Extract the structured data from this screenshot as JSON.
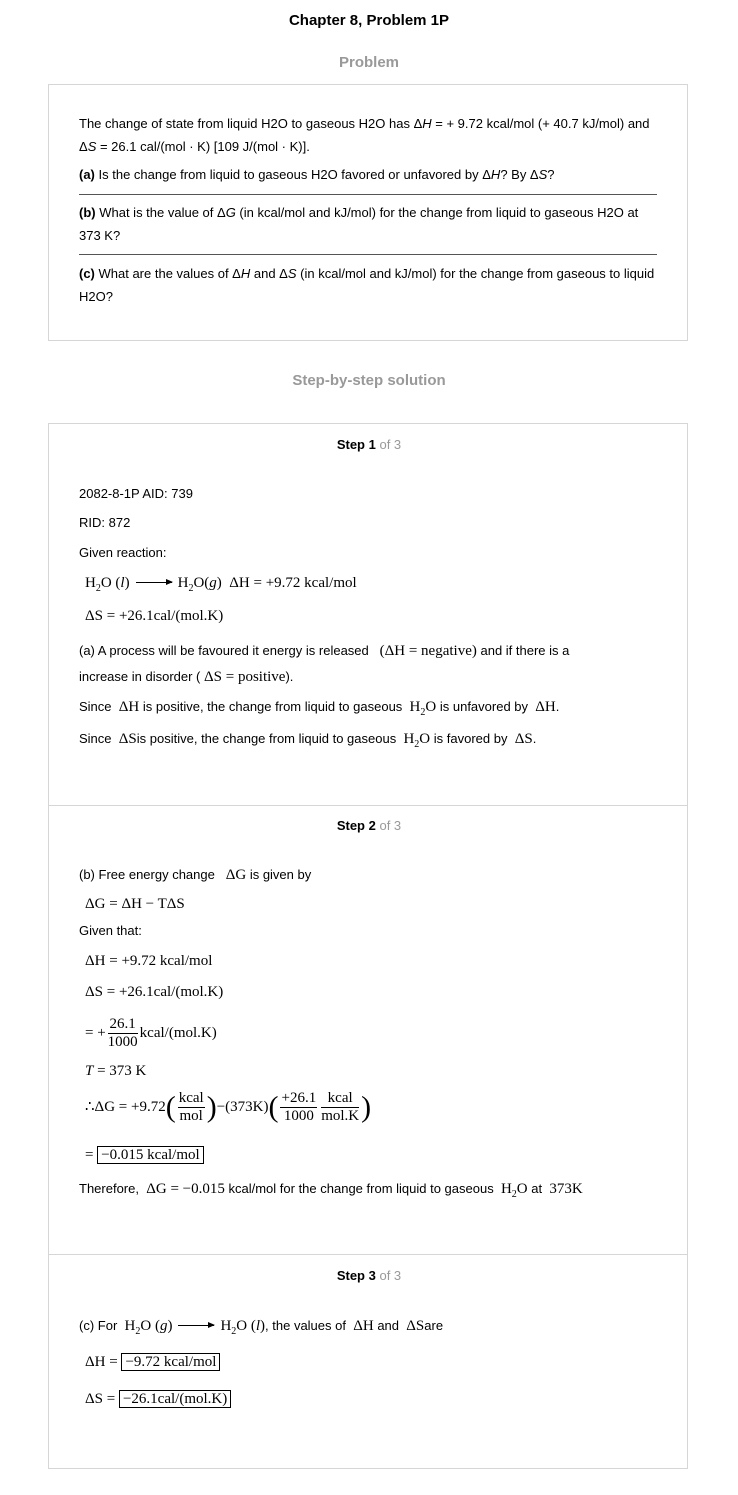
{
  "title": "Chapter 8, Problem 1P",
  "problem_heading": "Problem",
  "problem": {
    "intro_a": "The change of state from liquid H2O to gaseous H2O has Δ",
    "intro_h": "H",
    "intro_b": " = + 9.72 kcal/mol (+ 40.7 kJ/mol) and Δ",
    "intro_s": "S",
    "intro_c": " = 26.1 cal/(mol · K) [109 J/(mol · K)].",
    "qa_label": "(a)",
    "qa_text_a": " Is the change from liquid to gaseous H2O favored or unfavored by Δ",
    "qa_h": "H",
    "qa_text_b": "? By Δ",
    "qa_s": "S",
    "qa_text_c": "?",
    "qb_label": "(b)",
    "qb_text_a": " What is the value of Δ",
    "qb_g": "G",
    "qb_text_b": " (in kcal/mol and kJ/mol) for the change from liquid to gaseous H2O at 373 K?",
    "qc_label": "(c)",
    "qc_text_a": " What are the values of Δ",
    "qc_h": "H",
    "qc_text_b": " and Δ",
    "qc_s": "S",
    "qc_text_c": " (in kcal/mol and kJ/mol) for the change from gaseous to liquid H2O?"
  },
  "solution_heading": "Step-by-step solution",
  "steps": [
    {
      "label": "Step 1",
      "of": "of 3"
    },
    {
      "label": "Step 2",
      "of": "of 3"
    },
    {
      "label": "Step 3",
      "of": "of 3"
    }
  ],
  "step1": {
    "aid": "2082-8-1P AID: 739",
    "rid": "RID: 872",
    "given": "Given reaction:",
    "eq_rhs": "ΔH = +9.72 kcal/mol",
    "ds": "ΔS = +26.1cal/",
    "ds_unit": "mol.K",
    "a_text1": "(a) A process will be favoured it energy is released",
    "a_math1": "ΔH = negative",
    "a_text2": "and if there is a",
    "a_text3": "increase in disorder (",
    "a_math2": "ΔS = positive",
    "a_text4": ").",
    "since1_a": "Since",
    "since1_m": "ΔH",
    "since1_b": "is positive, the change from liquid to gaseous",
    "since1_c": "is unfavored by",
    "since1_d": "ΔH",
    "since2_a": "Since",
    "since2_m": "ΔS",
    "since2_b": "is positive, the change from liquid to gaseous",
    "since2_c": "is favored by",
    "since2_d": "ΔS"
  },
  "step2": {
    "intro_a": "(b) Free energy change",
    "intro_m": "ΔG",
    "intro_b": "is given by",
    "formula": "ΔG = ΔH − TΔS",
    "given": "Given that:",
    "dh": "ΔH   = +9.72 kcal/mol",
    "ds": "ΔS = +26.1cal/",
    "ds_unit": "mol.K",
    "frac_num": "26.1",
    "frac_den": "1000",
    "frac_unit": "kcal/",
    "t": "= 373 K",
    "calc_prefix": "∴ΔG = +9.72",
    "calc_kcal": "kcal",
    "calc_mol": "mol",
    "calc_mid": "−(373K)",
    "calc_n1": "+26.1",
    "calc_d1": "1000",
    "calc_n2": "kcal",
    "calc_d2": "mol.K",
    "result": "−0.015 kcal/mol",
    "therefore_a": "Therefore,",
    "therefore_m": "ΔG = −0.015",
    "therefore_b": "kcal/mol for the change from liquid to gaseous",
    "therefore_c": "at",
    "therefore_t": "373K"
  },
  "step3": {
    "intro_a": "(c) For",
    "intro_b": ", the values of",
    "intro_dh": "ΔH",
    "intro_and": "and",
    "intro_ds": "ΔS",
    "intro_are": "are",
    "dh_lhs": "ΔH =",
    "dh_val": "−9.72 kcal/mol",
    "ds_lhs": "ΔS =",
    "ds_val": "−26.1cal/",
    "ds_unit": "mol.K"
  }
}
